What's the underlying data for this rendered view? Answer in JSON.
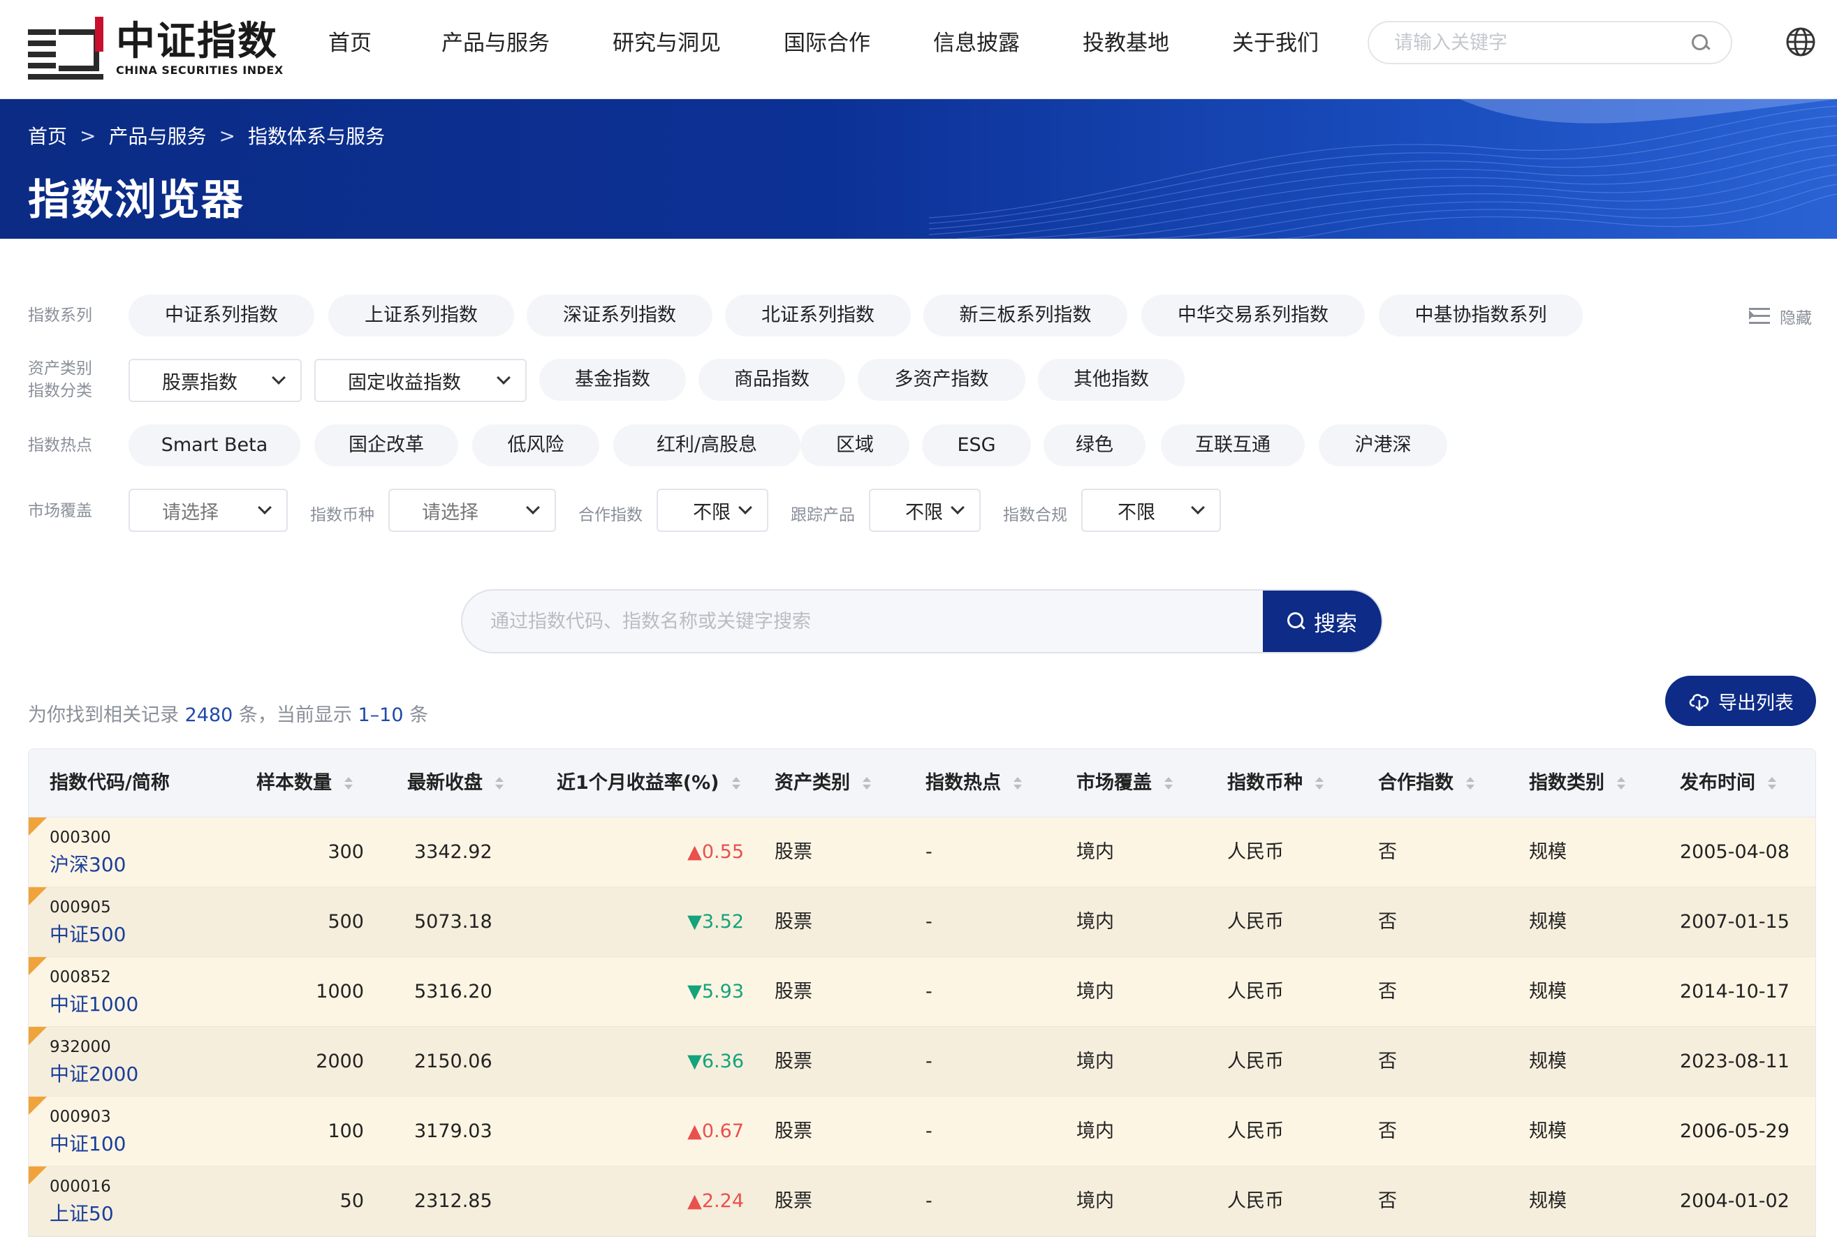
{
  "logo": {
    "cn": "中证指数",
    "en": "CHINA SECURITIES INDEX"
  },
  "nav": [
    "首页",
    "产品与服务",
    "研究与洞见",
    "国际合作",
    "信息披露",
    "投教基地",
    "关于我们"
  ],
  "top_search": {
    "placeholder": "请输入关键字"
  },
  "breadcrumb": [
    "首页",
    "产品与服务",
    "指数体系与服务"
  ],
  "breadcrumb_sep": ">",
  "page_title": "指数浏览器",
  "filters": {
    "series_label": "指数系列",
    "series": [
      "中证系列指数",
      "上证系列指数",
      "深证系列指数",
      "北证系列指数",
      "新三板系列指数",
      "中华交易系列指数",
      "中基协指数系列"
    ],
    "hide_label": "隐藏",
    "asset_label_1": "资产类别",
    "asset_label_2": "指数分类",
    "asset": [
      "股票指数",
      "固定收益指数",
      "基金指数",
      "商品指数",
      "多资产指数",
      "其他指数"
    ],
    "hot_label": "指数热点",
    "hot": [
      "Smart Beta",
      "国企改革",
      "低风险",
      "红利/高股息",
      "区域",
      "ESG",
      "绿色",
      "互联互通",
      "沪港深"
    ],
    "market_label": "市场覆盖",
    "market_value": "请选择",
    "currency_label": "指数币种",
    "currency_value": "请选择",
    "coop_label": "合作指数",
    "coop_value": "不限",
    "track_label": "跟踪产品",
    "track_value": "不限",
    "comply_label": "指数合规",
    "comply_value": "不限"
  },
  "main_search": {
    "placeholder": "通过指数代码、指数名称或关键字搜索",
    "button": "搜索"
  },
  "results": {
    "prefix": "为你找到相关记录",
    "total": "2480",
    "mid": "条，当前显示",
    "range": "1–10",
    "suffix": "条"
  },
  "export_label": "导出列表",
  "table": {
    "headers": [
      "指数代码/简称",
      "样本数量",
      "最新收盘",
      "近1个月收益率(%)",
      "资产类别",
      "指数热点",
      "市场覆盖",
      "指数币种",
      "合作指数",
      "指数类别",
      "发布时间"
    ],
    "rows": [
      {
        "code": "000300",
        "name": "沪深300",
        "count": "300",
        "close": "3342.92",
        "ret": "▲0.55",
        "dir": "up",
        "asset": "股票",
        "hot": "-",
        "market": "境内",
        "currency": "人民币",
        "coop": "否",
        "category": "规模",
        "date": "2005-04-08"
      },
      {
        "code": "000905",
        "name": "中证500",
        "count": "500",
        "close": "5073.18",
        "ret": "▼3.52",
        "dir": "down",
        "asset": "股票",
        "hot": "-",
        "market": "境内",
        "currency": "人民币",
        "coop": "否",
        "category": "规模",
        "date": "2007-01-15"
      },
      {
        "code": "000852",
        "name": "中证1000",
        "count": "1000",
        "close": "5316.20",
        "ret": "▼5.93",
        "dir": "down",
        "asset": "股票",
        "hot": "-",
        "market": "境内",
        "currency": "人民币",
        "coop": "否",
        "category": "规模",
        "date": "2014-10-17"
      },
      {
        "code": "932000",
        "name": "中证2000",
        "count": "2000",
        "close": "2150.06",
        "ret": "▼6.36",
        "dir": "down",
        "asset": "股票",
        "hot": "-",
        "market": "境内",
        "currency": "人民币",
        "coop": "否",
        "category": "规模",
        "date": "2023-08-11"
      },
      {
        "code": "000903",
        "name": "中证100",
        "count": "100",
        "close": "3179.03",
        "ret": "▲0.67",
        "dir": "up",
        "asset": "股票",
        "hot": "-",
        "market": "境内",
        "currency": "人民币",
        "coop": "否",
        "category": "规模",
        "date": "2006-05-29"
      },
      {
        "code": "000016",
        "name": "上证50",
        "count": "50",
        "close": "2312.85",
        "ret": "▲2.24",
        "dir": "up",
        "asset": "股票",
        "hot": "-",
        "market": "境内",
        "currency": "人民币",
        "coop": "否",
        "category": "规模",
        "date": "2004-01-02"
      }
    ]
  },
  "colors": {
    "brand": "#0d2b87",
    "up": "#e8514e",
    "down": "#14a37a",
    "row": "#fdf5e4"
  },
  "icons": {
    "search": "search-icon",
    "globe": "globe-icon",
    "export": "cloud-download-icon",
    "hide": "collapse-list-icon",
    "sort": "sort-icon",
    "chevron": "chevron-down-icon"
  }
}
